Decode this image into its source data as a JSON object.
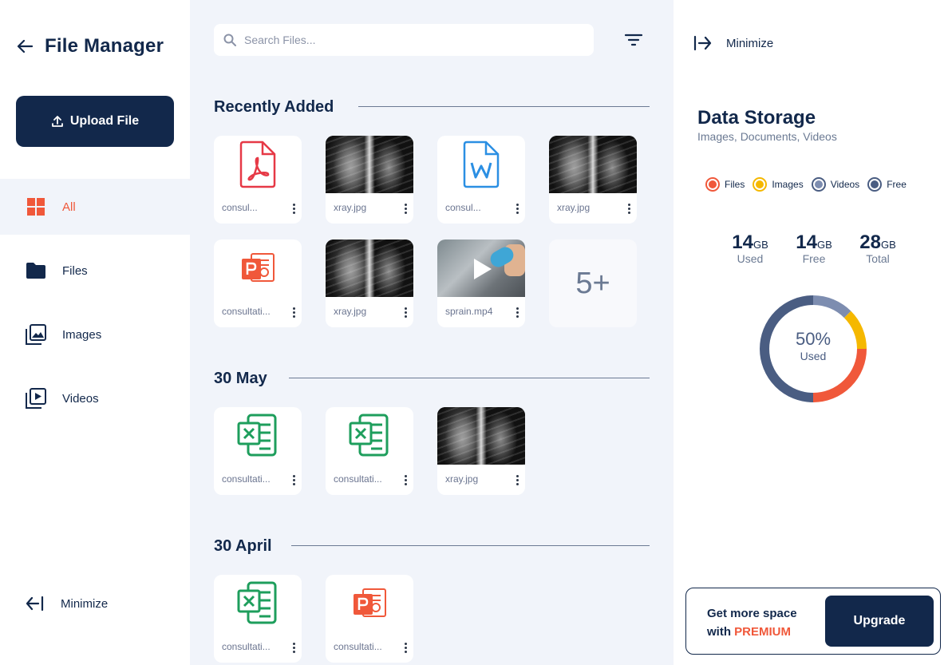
{
  "sidebar": {
    "title": "File Manager",
    "upload_label": "Upload File",
    "nav": [
      {
        "label": "All",
        "icon": "grid-icon"
      },
      {
        "label": "Files",
        "icon": "folder-icon"
      },
      {
        "label": "Images",
        "icon": "images-icon"
      },
      {
        "label": "Videos",
        "icon": "video-icon"
      }
    ],
    "minimize_label": "Minimize"
  },
  "main": {
    "search_placeholder": "Search Files...",
    "sections": [
      {
        "title": "Recently Added",
        "files": [
          {
            "name": "consul...",
            "type": "pdf"
          },
          {
            "name": "xray.jpg",
            "type": "image"
          },
          {
            "name": "consul...",
            "type": "word"
          },
          {
            "name": "xray.jpg",
            "type": "image"
          },
          {
            "name": "consultati...",
            "type": "powerpoint"
          },
          {
            "name": "xray.jpg",
            "type": "image"
          },
          {
            "name": "sprain.mp4",
            "type": "video"
          }
        ],
        "more_label": "5+"
      },
      {
        "title": "30 May",
        "files": [
          {
            "name": "consultati...",
            "type": "excel"
          },
          {
            "name": "consultati...",
            "type": "excel"
          },
          {
            "name": "xray.jpg",
            "type": "image"
          }
        ]
      },
      {
        "title": "30 April",
        "files": [
          {
            "name": "consultati...",
            "type": "excel"
          },
          {
            "name": "consultati...",
            "type": "powerpoint"
          }
        ]
      }
    ]
  },
  "storage": {
    "minimize_label": "Minimize",
    "title": "Data Storage",
    "subtitle": "Images, Documents, Videos",
    "legend": [
      {
        "label": "Files",
        "color": "#f0583a"
      },
      {
        "label": "Images",
        "color": "#f5b800"
      },
      {
        "label": "Videos",
        "color": "#7d8db0"
      },
      {
        "label": "Free",
        "color": "#4a5d82"
      }
    ],
    "stats": [
      {
        "value": "14",
        "unit": "GB",
        "label": "Used"
      },
      {
        "value": "14",
        "unit": "GB",
        "label": "Free"
      },
      {
        "value": "28",
        "unit": "GB",
        "label": "Total"
      }
    ],
    "donut": {
      "percent_label": "50%",
      "label": "Used",
      "segments": [
        {
          "name": "Files",
          "fraction": 0.25,
          "color": "#f0583a"
        },
        {
          "name": "Images",
          "fraction": 0.125,
          "color": "#f5b800"
        },
        {
          "name": "Videos",
          "fraction": 0.125,
          "color": "#7d8db0"
        },
        {
          "name": "Free",
          "fraction": 0.5,
          "color": "#4a5d82"
        }
      ]
    },
    "promo_line1": "Get more space",
    "promo_with": "with",
    "promo_premium": "PREMIUM",
    "upgrade_label": "Upgrade"
  }
}
